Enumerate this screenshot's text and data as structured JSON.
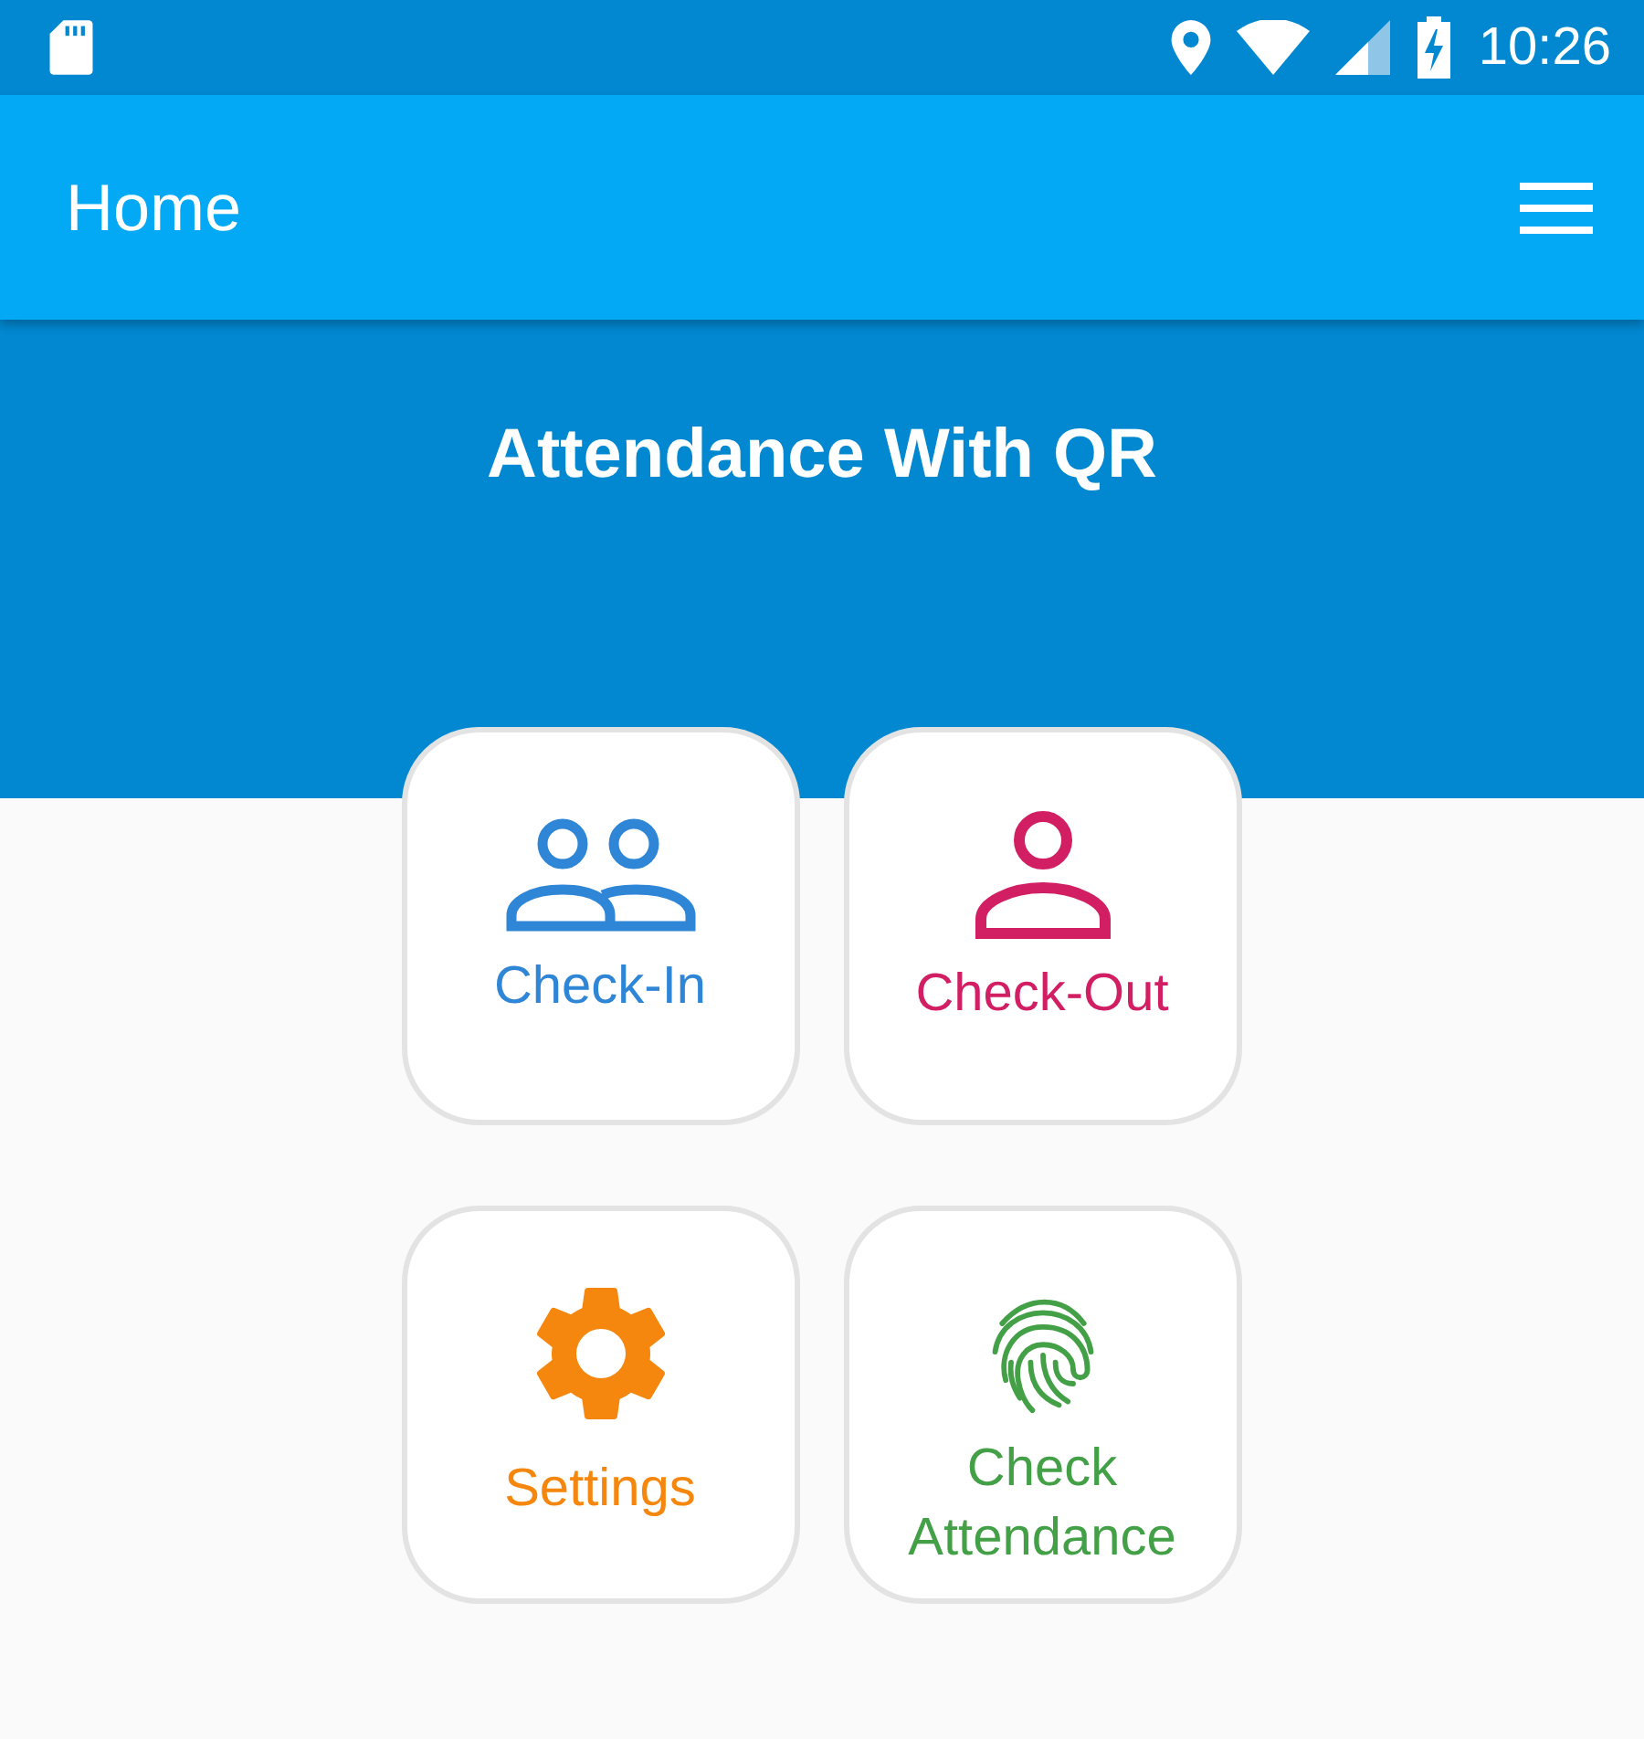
{
  "status_bar": {
    "time": "10:26"
  },
  "app_bar": {
    "title": "Home"
  },
  "header": {
    "title": "Attendance With QR"
  },
  "tiles": [
    {
      "kind": "people",
      "label": "Check-In",
      "color": "#2f86d6"
    },
    {
      "kind": "person",
      "label": "Check-Out",
      "color": "#d21f64"
    },
    {
      "kind": "gear",
      "label": "Settings",
      "color": "#f5870f"
    },
    {
      "kind": "fingerprint",
      "label": "Check Attendance",
      "color": "#43a047"
    }
  ]
}
